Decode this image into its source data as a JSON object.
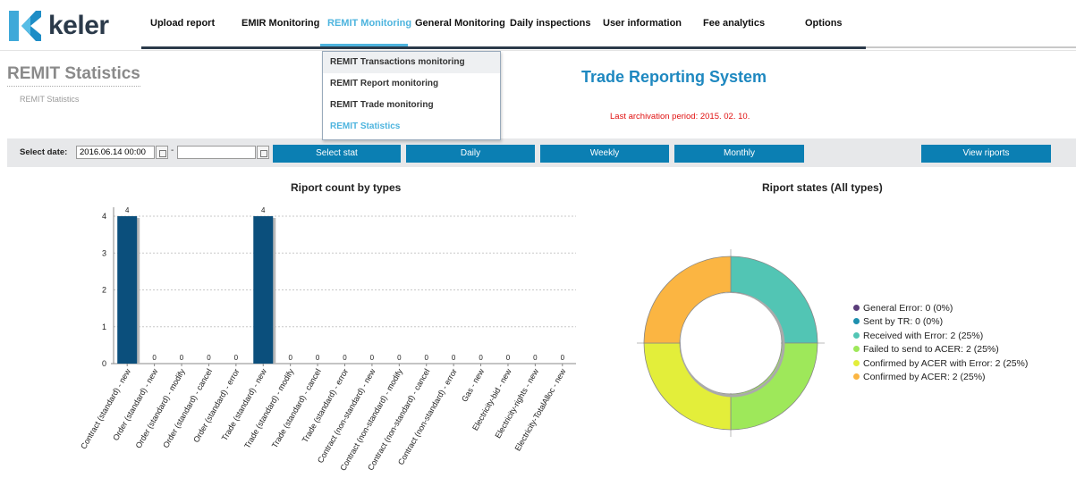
{
  "brand": {
    "name": "keler"
  },
  "nav": [
    {
      "label": "Upload report",
      "active": false
    },
    {
      "label": "EMIR Monitoring",
      "active": false
    },
    {
      "label": "REMIT Monitoring",
      "active": true
    },
    {
      "label": "General Monitoring",
      "active": false
    },
    {
      "label": "Daily inspections",
      "active": false
    },
    {
      "label": "User information",
      "active": false
    },
    {
      "label": "Fee analytics",
      "active": false
    },
    {
      "label": "Options",
      "active": false
    }
  ],
  "dropdown": [
    {
      "label": "REMIT Transactions monitoring",
      "selected": false
    },
    {
      "label": "REMIT Report monitoring",
      "selected": false
    },
    {
      "label": "REMIT Trade monitoring",
      "selected": false
    },
    {
      "label": "REMIT Statistics",
      "selected": true
    }
  ],
  "page": {
    "title": "REMIT Statistics",
    "breadcrumb": "REMIT Statistics"
  },
  "system": {
    "title": "Trade Reporting System",
    "archive": "Last archivation period: 2015. 02. 10."
  },
  "filter": {
    "label": "Select date:",
    "from": "2016.06.14 00:00",
    "to": "",
    "dash": "-",
    "buttons": {
      "select": "Select stat",
      "daily": "Daily",
      "weekly": "Weekly",
      "monthly": "Monthly",
      "view": "View riports"
    }
  },
  "colors": {
    "accent": "#4db4de",
    "button": "#0b7fb3",
    "bar": "#0b4f7c",
    "title_blue": "#1e88c0",
    "archive": "#e01010"
  },
  "chart_data": [
    {
      "type": "bar",
      "title": "Riport count by types",
      "categories": [
        "Contract (standard) - new",
        "Order (standard) - new",
        "Order (standard) - modify",
        "Order (standard) - cancel",
        "Order (standard) - error",
        "Trade (standard) - new",
        "Trade (standard) - modify",
        "Trade (standard) - cancel",
        "Trade (standard) - error",
        "Contract (non-standard) - new",
        "Contract (non-standard) - modify",
        "Contract (non-standard) - cancel",
        "Contract (non-standard) - error",
        "Gas - new",
        "Electricity-bid - new",
        "Electricity-rights - new",
        "Electricity-TotalAlloc - new"
      ],
      "values": [
        4,
        0,
        0,
        0,
        0,
        4,
        0,
        0,
        0,
        0,
        0,
        0,
        0,
        0,
        0,
        0,
        0
      ],
      "yticks": [
        0,
        1,
        2,
        3,
        4
      ],
      "ylim": [
        0,
        4
      ],
      "grid": true
    },
    {
      "type": "pie",
      "title": "Riport states (All types)",
      "donut": true,
      "slices": [
        {
          "label": "General Error: 0 (0%)",
          "value": 0,
          "color": "#5a3d7a"
        },
        {
          "label": "Sent by TR: 0 (0%)",
          "value": 0,
          "color": "#1d8fae"
        },
        {
          "label": "Received with Error: 2 (25%)",
          "value": 2,
          "color": "#52c5b4"
        },
        {
          "label": "Failed to send to ACER: 2 (25%)",
          "value": 2,
          "color": "#9ee85a"
        },
        {
          "label": "Confirmed by ACER with Error: 2 (25%)",
          "value": 2,
          "color": "#e3ee3a"
        },
        {
          "label": "Confirmed by ACER: 2 (25%)",
          "value": 2,
          "color": "#fbb542"
        }
      ],
      "legend_position": "right"
    }
  ]
}
